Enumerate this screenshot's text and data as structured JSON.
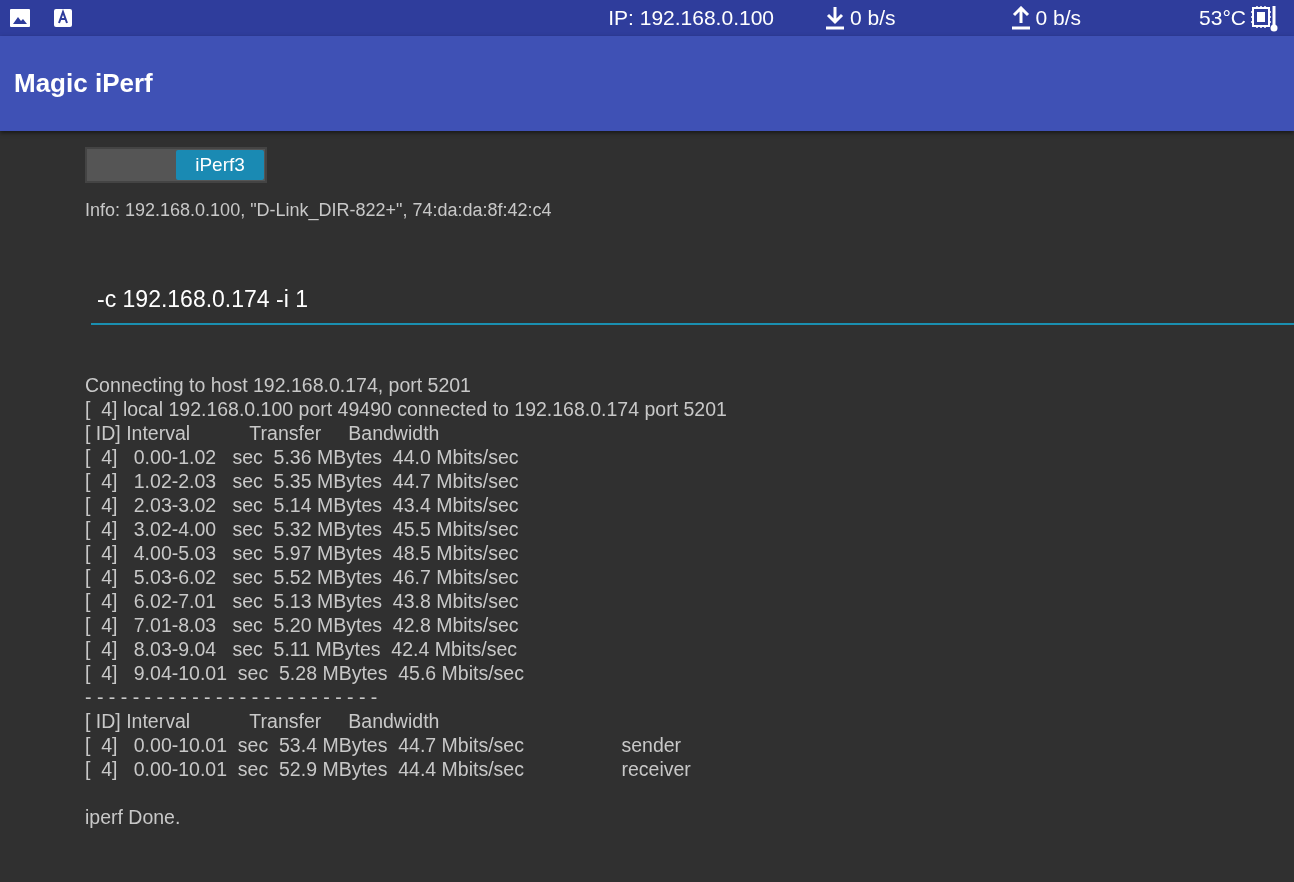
{
  "status_bar": {
    "ip": "IP: 192.168.0.100",
    "download": "0 b/s",
    "upload": "0 b/s",
    "temperature": "53°C"
  },
  "app_bar": {
    "title": "Magic iPerf"
  },
  "mode_toggle": {
    "label": "iPerf3",
    "on": true
  },
  "info": "Info: 192.168.0.100, \"D-Link_DIR-822+\", 74:da:da:8f:42:c4",
  "command_field": {
    "value": "-c 192.168.0.174 -i 1"
  },
  "output": [
    "Connecting to host 192.168.0.174, port 5201",
    "[  4] local 192.168.0.100 port 49490 connected to 192.168.0.174 port 5201",
    "[ ID] Interval           Transfer     Bandwidth",
    "[  4]   0.00-1.02   sec  5.36 MBytes  44.0 Mbits/sec",
    "[  4]   1.02-2.03   sec  5.35 MBytes  44.7 Mbits/sec",
    "[  4]   2.03-3.02   sec  5.14 MBytes  43.4 Mbits/sec",
    "[  4]   3.02-4.00   sec  5.32 MBytes  45.5 Mbits/sec",
    "[  4]   4.00-5.03   sec  5.97 MBytes  48.5 Mbits/sec",
    "[  4]   5.03-6.02   sec  5.52 MBytes  46.7 Mbits/sec",
    "[  4]   6.02-7.01   sec  5.13 MBytes  43.8 Mbits/sec",
    "[  4]   7.01-8.03   sec  5.20 MBytes  42.8 Mbits/sec",
    "[  4]   8.03-9.04   sec  5.11 MBytes  42.4 Mbits/sec",
    "[  4]   9.04-10.01  sec  5.28 MBytes  45.6 Mbits/sec",
    "- - - - - - - - - - - - - - - - - - - - - - - - -",
    "[ ID] Interval           Transfer     Bandwidth",
    "[  4]   0.00-10.01  sec  53.4 MBytes  44.7 Mbits/sec                  sender",
    "[  4]   0.00-10.01  sec  52.9 MBytes  44.4 Mbits/sec                  receiver"
  ],
  "done_message": "iperf Done."
}
